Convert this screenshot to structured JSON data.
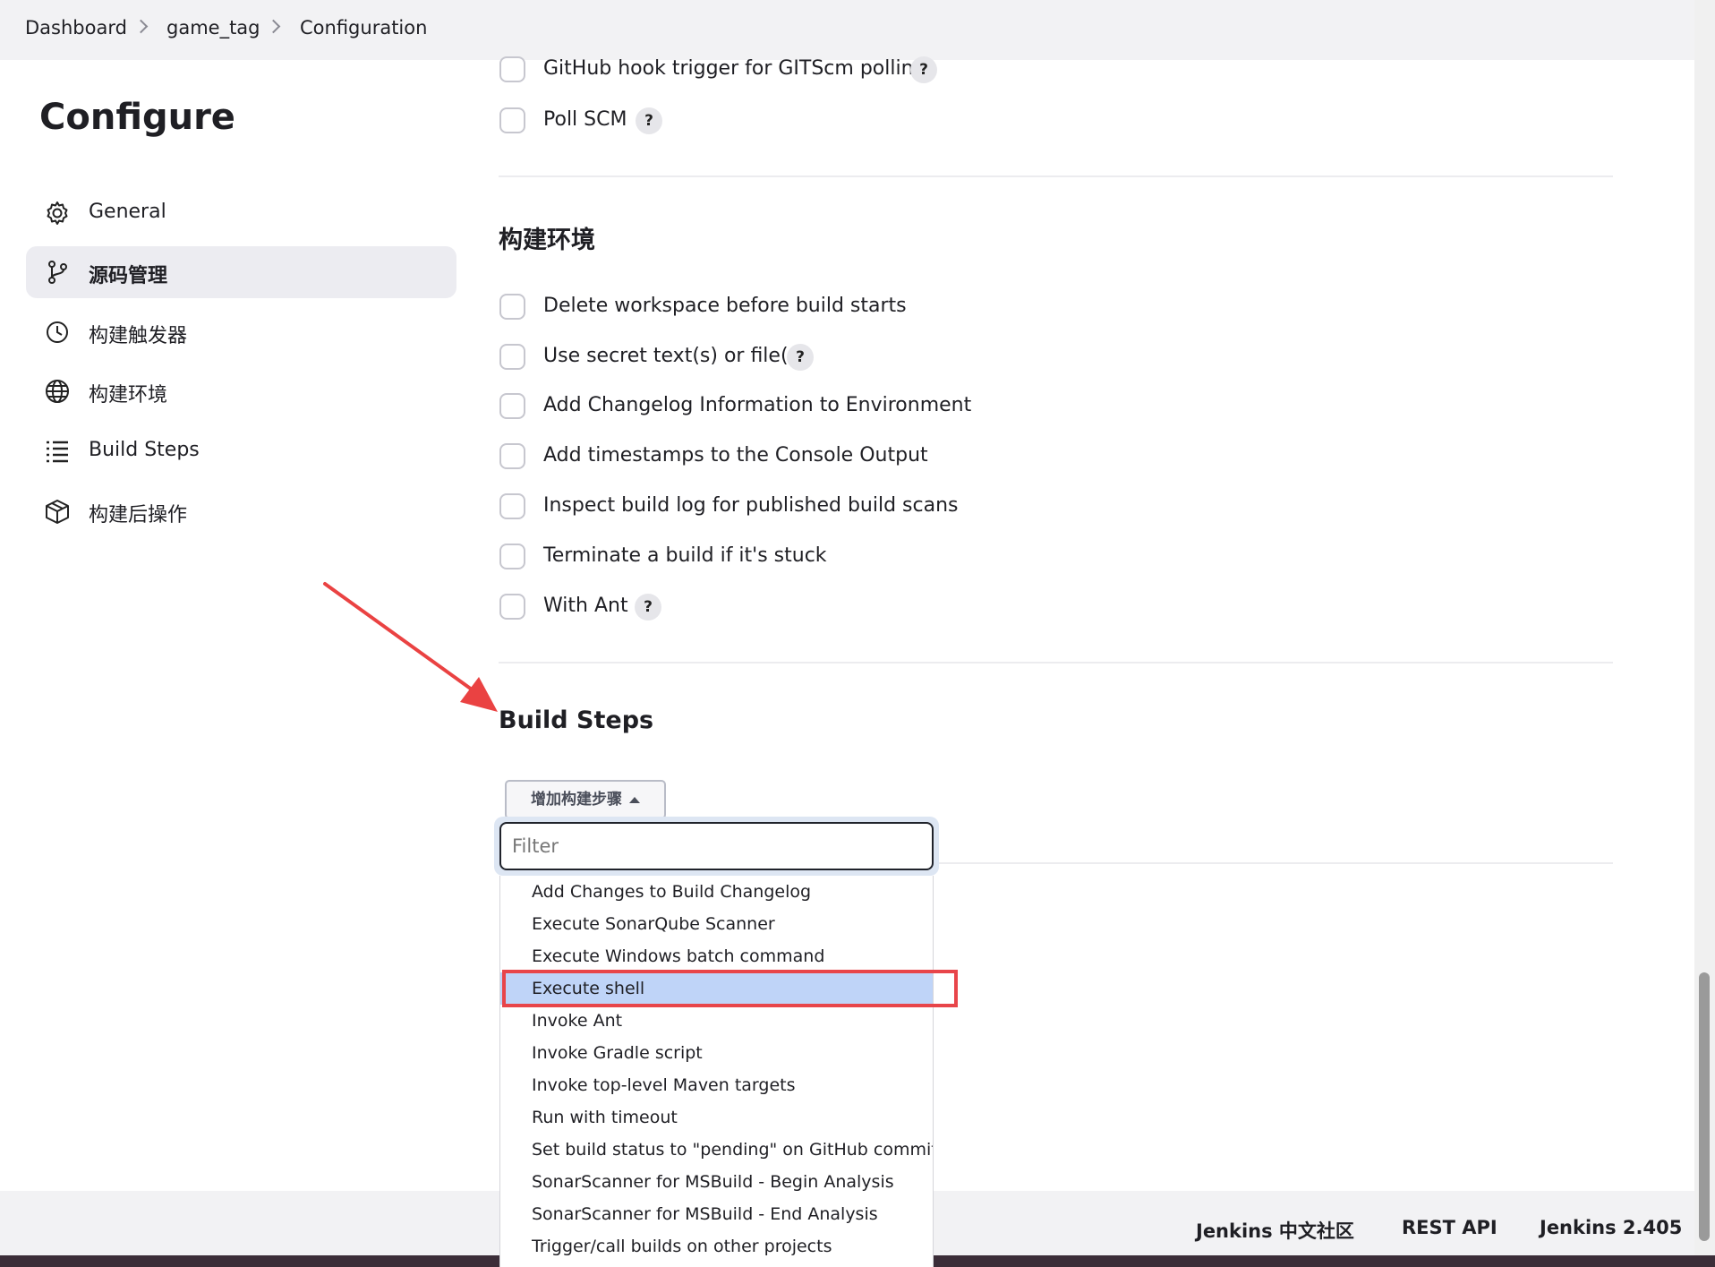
{
  "breadcrumb": {
    "items": [
      "Dashboard",
      "game_tag",
      "Configuration"
    ]
  },
  "sidebar": {
    "title": "Configure",
    "items": [
      {
        "label": "General",
        "icon": "gear-icon"
      },
      {
        "label": "源码管理",
        "icon": "source-control-icon",
        "active": true
      },
      {
        "label": "构建触发器",
        "icon": "clock-icon"
      },
      {
        "label": "构建环境",
        "icon": "globe-icon"
      },
      {
        "label": "Build Steps",
        "icon": "list-icon"
      },
      {
        "label": "构建后操作",
        "icon": "package-icon"
      }
    ]
  },
  "triggers": {
    "options": [
      {
        "label": "GitHub hook trigger for GITScm polling",
        "help": "?"
      },
      {
        "label": "Poll SCM",
        "help": "?"
      }
    ]
  },
  "build_env": {
    "title": "构建环境",
    "options": [
      {
        "label": "Delete workspace before build starts"
      },
      {
        "label": "Use secret text(s) or file(s)",
        "help": "?"
      },
      {
        "label": "Add Changelog Information to Environment"
      },
      {
        "label": "Add timestamps to the Console Output"
      },
      {
        "label": "Inspect build log for published build scans"
      },
      {
        "label": "Terminate a build if it's stuck"
      },
      {
        "label": "With Ant",
        "help": "?"
      }
    ]
  },
  "build_steps": {
    "title": "Build Steps",
    "add_button": "增加构建步骤",
    "filter_placeholder": "Filter",
    "menu": [
      "Add Changes to Build Changelog",
      "Execute SonarQube Scanner",
      "Execute Windows batch command",
      "Execute shell",
      "Invoke Ant",
      "Invoke Gradle script",
      "Invoke top-level Maven targets",
      "Run with timeout",
      "Set build status to \"pending\" on GitHub commit",
      "SonarScanner for MSBuild - Begin Analysis",
      "SonarScanner for MSBuild - End Analysis",
      "Trigger/call builds on other projects"
    ],
    "highlighted": "Execute shell"
  },
  "footer": {
    "links": [
      "Jenkins 中文社区",
      "REST API",
      "Jenkins 2.405"
    ]
  },
  "colors": {
    "highlight_box": "#e8454a",
    "menu_highlight": "#bfd4f8",
    "arrow": "#ea4242"
  }
}
